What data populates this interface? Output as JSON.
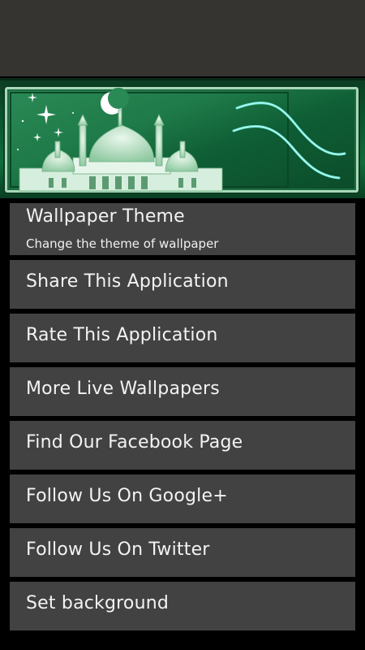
{
  "banner": {
    "image": "mosque-with-crescent-moon-banner",
    "colors": {
      "bg": "#0f6d3c",
      "frame": "#a7d8b7",
      "glow": "#7ff3e8"
    }
  },
  "menu": {
    "items": [
      {
        "title": "Wallpaper Theme",
        "summary": "Change the theme of wallpaper"
      },
      {
        "title": "Share This Application"
      },
      {
        "title": "Rate This Application"
      },
      {
        "title": "More Live Wallpapers"
      },
      {
        "title": "Find Our Facebook Page"
      },
      {
        "title": "Follow Us On Google+"
      },
      {
        "title": "Follow Us On Twitter"
      },
      {
        "title": "Set background"
      }
    ]
  }
}
